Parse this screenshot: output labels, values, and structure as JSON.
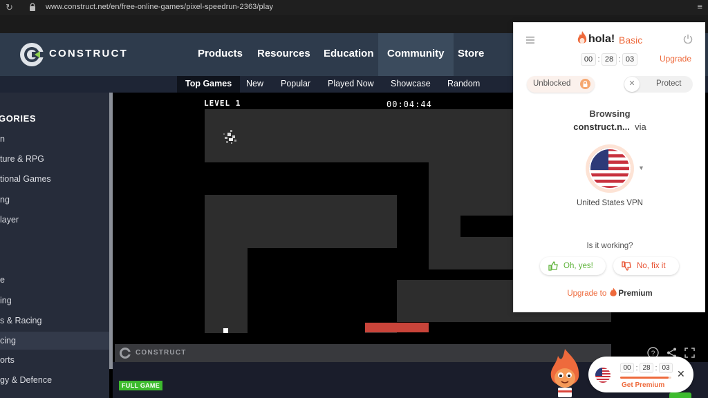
{
  "browser": {
    "url": "www.construct.net/en/free-online-games/pixel-speedrun-2363/play"
  },
  "site": {
    "logo_text": "CONSTRUCT",
    "nav": [
      {
        "label": "Products"
      },
      {
        "label": "Resources"
      },
      {
        "label": "Education"
      },
      {
        "label": "Community"
      },
      {
        "label": "Store"
      }
    ],
    "subnav": [
      {
        "label": "Top Games"
      },
      {
        "label": "New"
      },
      {
        "label": "Popular"
      },
      {
        "label": "Played Now"
      },
      {
        "label": "Showcase"
      },
      {
        "label": "Random"
      }
    ]
  },
  "sidebar": {
    "title": "GORIES",
    "items": [
      {
        "label": "n"
      },
      {
        "label": "ture & RPG"
      },
      {
        "label": "tional Games"
      },
      {
        "label": "ng"
      },
      {
        "label": "layer"
      },
      {
        "label": ""
      },
      {
        "label": ""
      },
      {
        "label": "e"
      },
      {
        "label": "ing"
      },
      {
        "label": "s & Racing"
      },
      {
        "label": "cing"
      },
      {
        "label": "orts"
      },
      {
        "label": "gy & Defence"
      }
    ]
  },
  "game": {
    "level": "LEVEL 1",
    "timer": "00:04:44",
    "footer_logo_text": "CONSTRUCT",
    "full_game_badge": "FULL GAME"
  },
  "hola": {
    "brand": "hola!",
    "plan": "Basic",
    "timer": [
      "00",
      "28",
      "03"
    ],
    "upgrade_link": "Upgrade",
    "unblocked_label": "Unblocked",
    "protect_label": "Protect",
    "browsing_label": "Browsing",
    "browsing_site": "construct.n...",
    "browsing_via": "via",
    "vpn_country": "United States VPN",
    "working_question": "Is it working?",
    "yes_label": "Oh, yes!",
    "no_label": "No, fix it",
    "upgrade_to": "Upgrade to",
    "premium": "Premium",
    "mini_timer": [
      "00",
      "28",
      "03"
    ],
    "mini_cta": "Get Premium",
    "mini_progress": 0.95,
    "accent": "#ee6a3c"
  }
}
